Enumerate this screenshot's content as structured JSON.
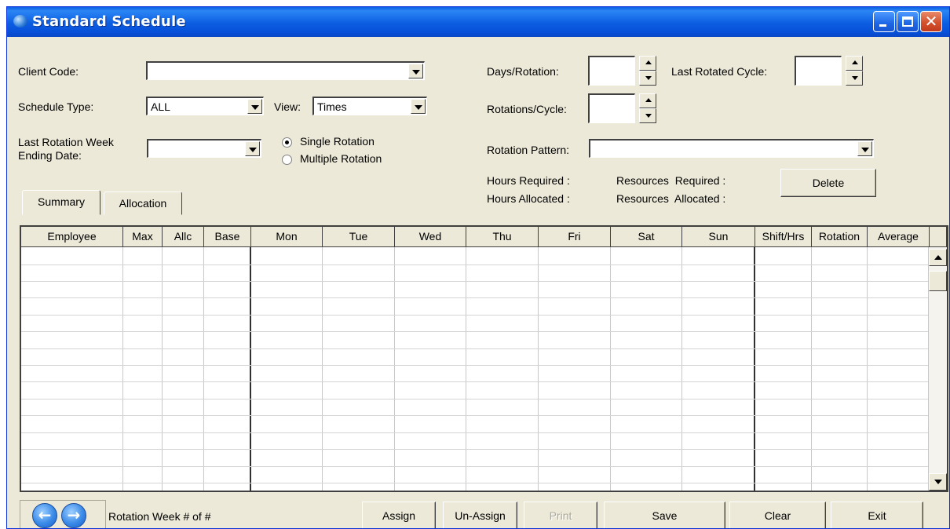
{
  "window": {
    "title": "Standard Schedule"
  },
  "form": {
    "client_code_label": "Client Code:",
    "client_code_value": "",
    "schedule_type_label": "Schedule Type:",
    "schedule_type_value": "ALL",
    "view_label": "View:",
    "view_value": "Times",
    "last_rotation_week_label_1": "Last Rotation Week",
    "last_rotation_week_label_2": "Ending Date:",
    "last_rotation_week_value": "",
    "single_rotation_label": "Single Rotation",
    "multiple_rotation_label": "Multiple Rotation",
    "selected_rotation": "single",
    "days_rotation_label": "Days/Rotation:",
    "days_rotation_value": "",
    "last_rotated_cycle_label": "Last Rotated Cycle:",
    "last_rotated_cycle_value": "",
    "rotations_cycle_label": "Rotations/Cycle:",
    "rotations_cycle_value": "",
    "rotation_pattern_label": "Rotation Pattern:",
    "rotation_pattern_value": "",
    "hours_required_label": "Hours Required :",
    "hours_allocated_label": "Hours Allocated :",
    "resources_required_label": "Resources  Required :",
    "resources_allocated_label": "Resources  Allocated :",
    "delete_label": "Delete"
  },
  "tabs": [
    {
      "label": "Summary",
      "active": true
    },
    {
      "label": "Allocation",
      "active": false
    }
  ],
  "grid": {
    "columns": [
      "Employee",
      "Max",
      "Allc",
      "Base",
      "Mon",
      "Tue",
      "Wed",
      "Thu",
      "Fri",
      "Sat",
      "Sun",
      "Shift/Hrs",
      "Rotation",
      "Average"
    ],
    "rows": []
  },
  "footer": {
    "rotation_week_text": "Rotation Week # of #",
    "buttons": {
      "assign": "Assign",
      "unassign": "Un-Assign",
      "print": "Print",
      "save": "Save",
      "clear": "Clear",
      "exit": "Exit"
    }
  },
  "colors": {
    "titlebar": "#0a5fe3",
    "window_bg": "#ece9d8"
  }
}
